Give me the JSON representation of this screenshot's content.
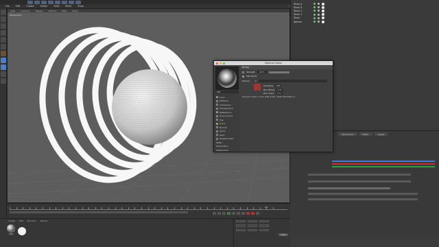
{
  "menus": [
    "File",
    "Edit",
    "Create",
    "Select",
    "Tools",
    "Mesh",
    "Snap"
  ],
  "viewport": {
    "menus": [
      "View",
      "Cameras",
      "Display",
      "Options",
      "Filter",
      "Panel"
    ],
    "label": "Perspective"
  },
  "objects": [
    {
      "name": "Torus 4"
    },
    {
      "name": "Torus 3"
    },
    {
      "name": "Torus 2"
    },
    {
      "name": "Torus 1"
    },
    {
      "name": "Torus"
    },
    {
      "name": "Sphere"
    }
  ],
  "attr_tabs": [
    "Illumination",
    "Editor",
    "Assign"
  ],
  "material_editor": {
    "title": "Material Editor",
    "material_name": "Mat",
    "channels": [
      {
        "name": "Color",
        "on": true
      },
      {
        "name": "Diffusion",
        "on": false
      },
      {
        "name": "Luminance",
        "on": false
      },
      {
        "name": "Transparency",
        "on": false
      },
      {
        "name": "Reflectance",
        "on": true
      },
      {
        "name": "Environment",
        "on": false
      },
      {
        "name": "Fog",
        "on": false
      },
      {
        "name": "Bump",
        "on": true,
        "selected": true
      },
      {
        "name": "Normal",
        "on": false
      },
      {
        "name": "Alpha",
        "on": false
      },
      {
        "name": "Glow",
        "on": false
      },
      {
        "name": "Displacement",
        "on": false
      },
      {
        "name": "Editor",
        "on": false
      },
      {
        "name": "Illumination",
        "on": false
      },
      {
        "name": "Assignment",
        "on": false
      }
    ],
    "section": "Bump",
    "strength_label": "Strength",
    "strength_value": "20 %",
    "mip_label": "MIP Falloff",
    "texture_label": "Texture",
    "sampling_label": "Sampling",
    "sampling_value": "MIP",
    "blur_offset_label": "Blur Offset",
    "blur_offset_value": "0 %",
    "blur_scale_label": "Blur Scale",
    "blur_scale_value": "0 %",
    "resolution": "Resolution 800 x 1152, RGB (8 Bit), sRGB IEC61966-2.1"
  },
  "timeline": {
    "frame": "0 F"
  },
  "material_manager": {
    "menus": [
      "Create",
      "Edit",
      "Function",
      "Texture"
    ],
    "material": "Mat"
  },
  "coords": {
    "apply": "Apply"
  },
  "colors": {
    "accent": "#e5a35a",
    "select_blue": "#4d7fc4",
    "viewport": "#5d5d5d",
    "panel": "#3a3a3a"
  }
}
